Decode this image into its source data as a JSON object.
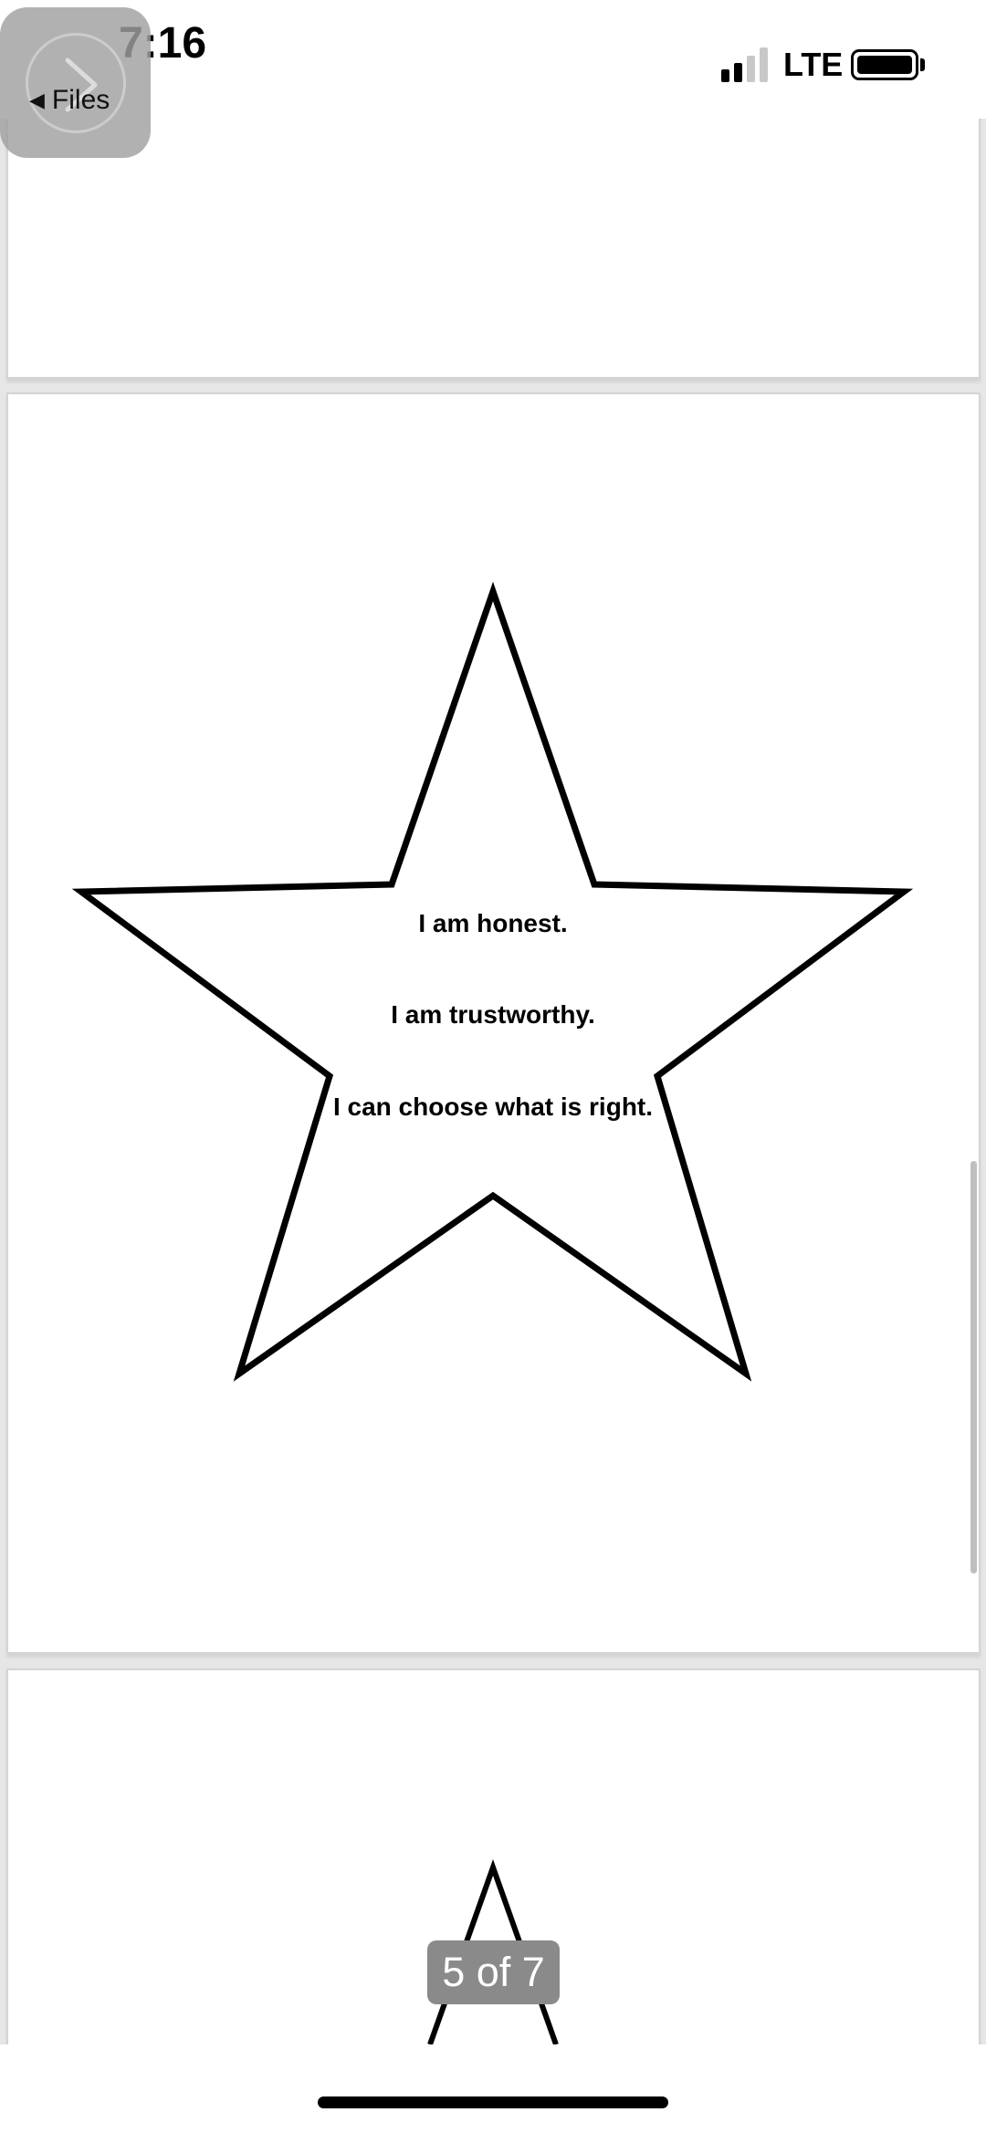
{
  "status_bar": {
    "time": "7:16",
    "carrier": "LTE",
    "signal_bars_active": 2,
    "signal_bars_total": 4
  },
  "back_button": {
    "label": "Files",
    "arrow": "◀"
  },
  "document": {
    "lines": [
      "I am honest.",
      "I am trustworthy.",
      "I can choose what is right."
    ],
    "page_counter": "5 of 7",
    "current_page": 5,
    "total_pages": 7
  },
  "icons": {
    "back": "chevron-right-icon",
    "signal": "signal-icon",
    "battery": "battery-icon"
  },
  "colors": {
    "outline": "#000000",
    "counter_bg": "#8a8a8a",
    "page_bg": "#ffffff"
  }
}
